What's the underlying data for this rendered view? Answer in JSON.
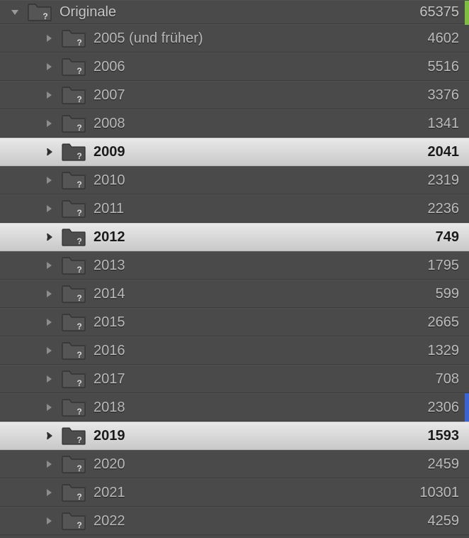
{
  "root": {
    "label": "Originale",
    "count": "65375"
  },
  "children": [
    {
      "label": "2005 (und früher)",
      "count": "4602",
      "selected": false
    },
    {
      "label": "2006",
      "count": "5516",
      "selected": false
    },
    {
      "label": "2007",
      "count": "3376",
      "selected": false
    },
    {
      "label": "2008",
      "count": "1341",
      "selected": false
    },
    {
      "label": "2009",
      "count": "2041",
      "selected": true
    },
    {
      "label": "2010",
      "count": "2319",
      "selected": false
    },
    {
      "label": "2011",
      "count": "2236",
      "selected": false
    },
    {
      "label": "2012",
      "count": "749",
      "selected": true
    },
    {
      "label": "2013",
      "count": "1795",
      "selected": false
    },
    {
      "label": "2014",
      "count": "599",
      "selected": false
    },
    {
      "label": "2015",
      "count": "2665",
      "selected": false
    },
    {
      "label": "2016",
      "count": "1329",
      "selected": false
    },
    {
      "label": "2017",
      "count": "708",
      "selected": false
    },
    {
      "label": "2018",
      "count": "2306",
      "selected": false
    },
    {
      "label": "2019",
      "count": "1593",
      "selected": true
    },
    {
      "label": "2020",
      "count": "2459",
      "selected": false
    },
    {
      "label": "2021",
      "count": "10301",
      "selected": false
    },
    {
      "label": "2022",
      "count": "4259",
      "selected": false
    }
  ]
}
